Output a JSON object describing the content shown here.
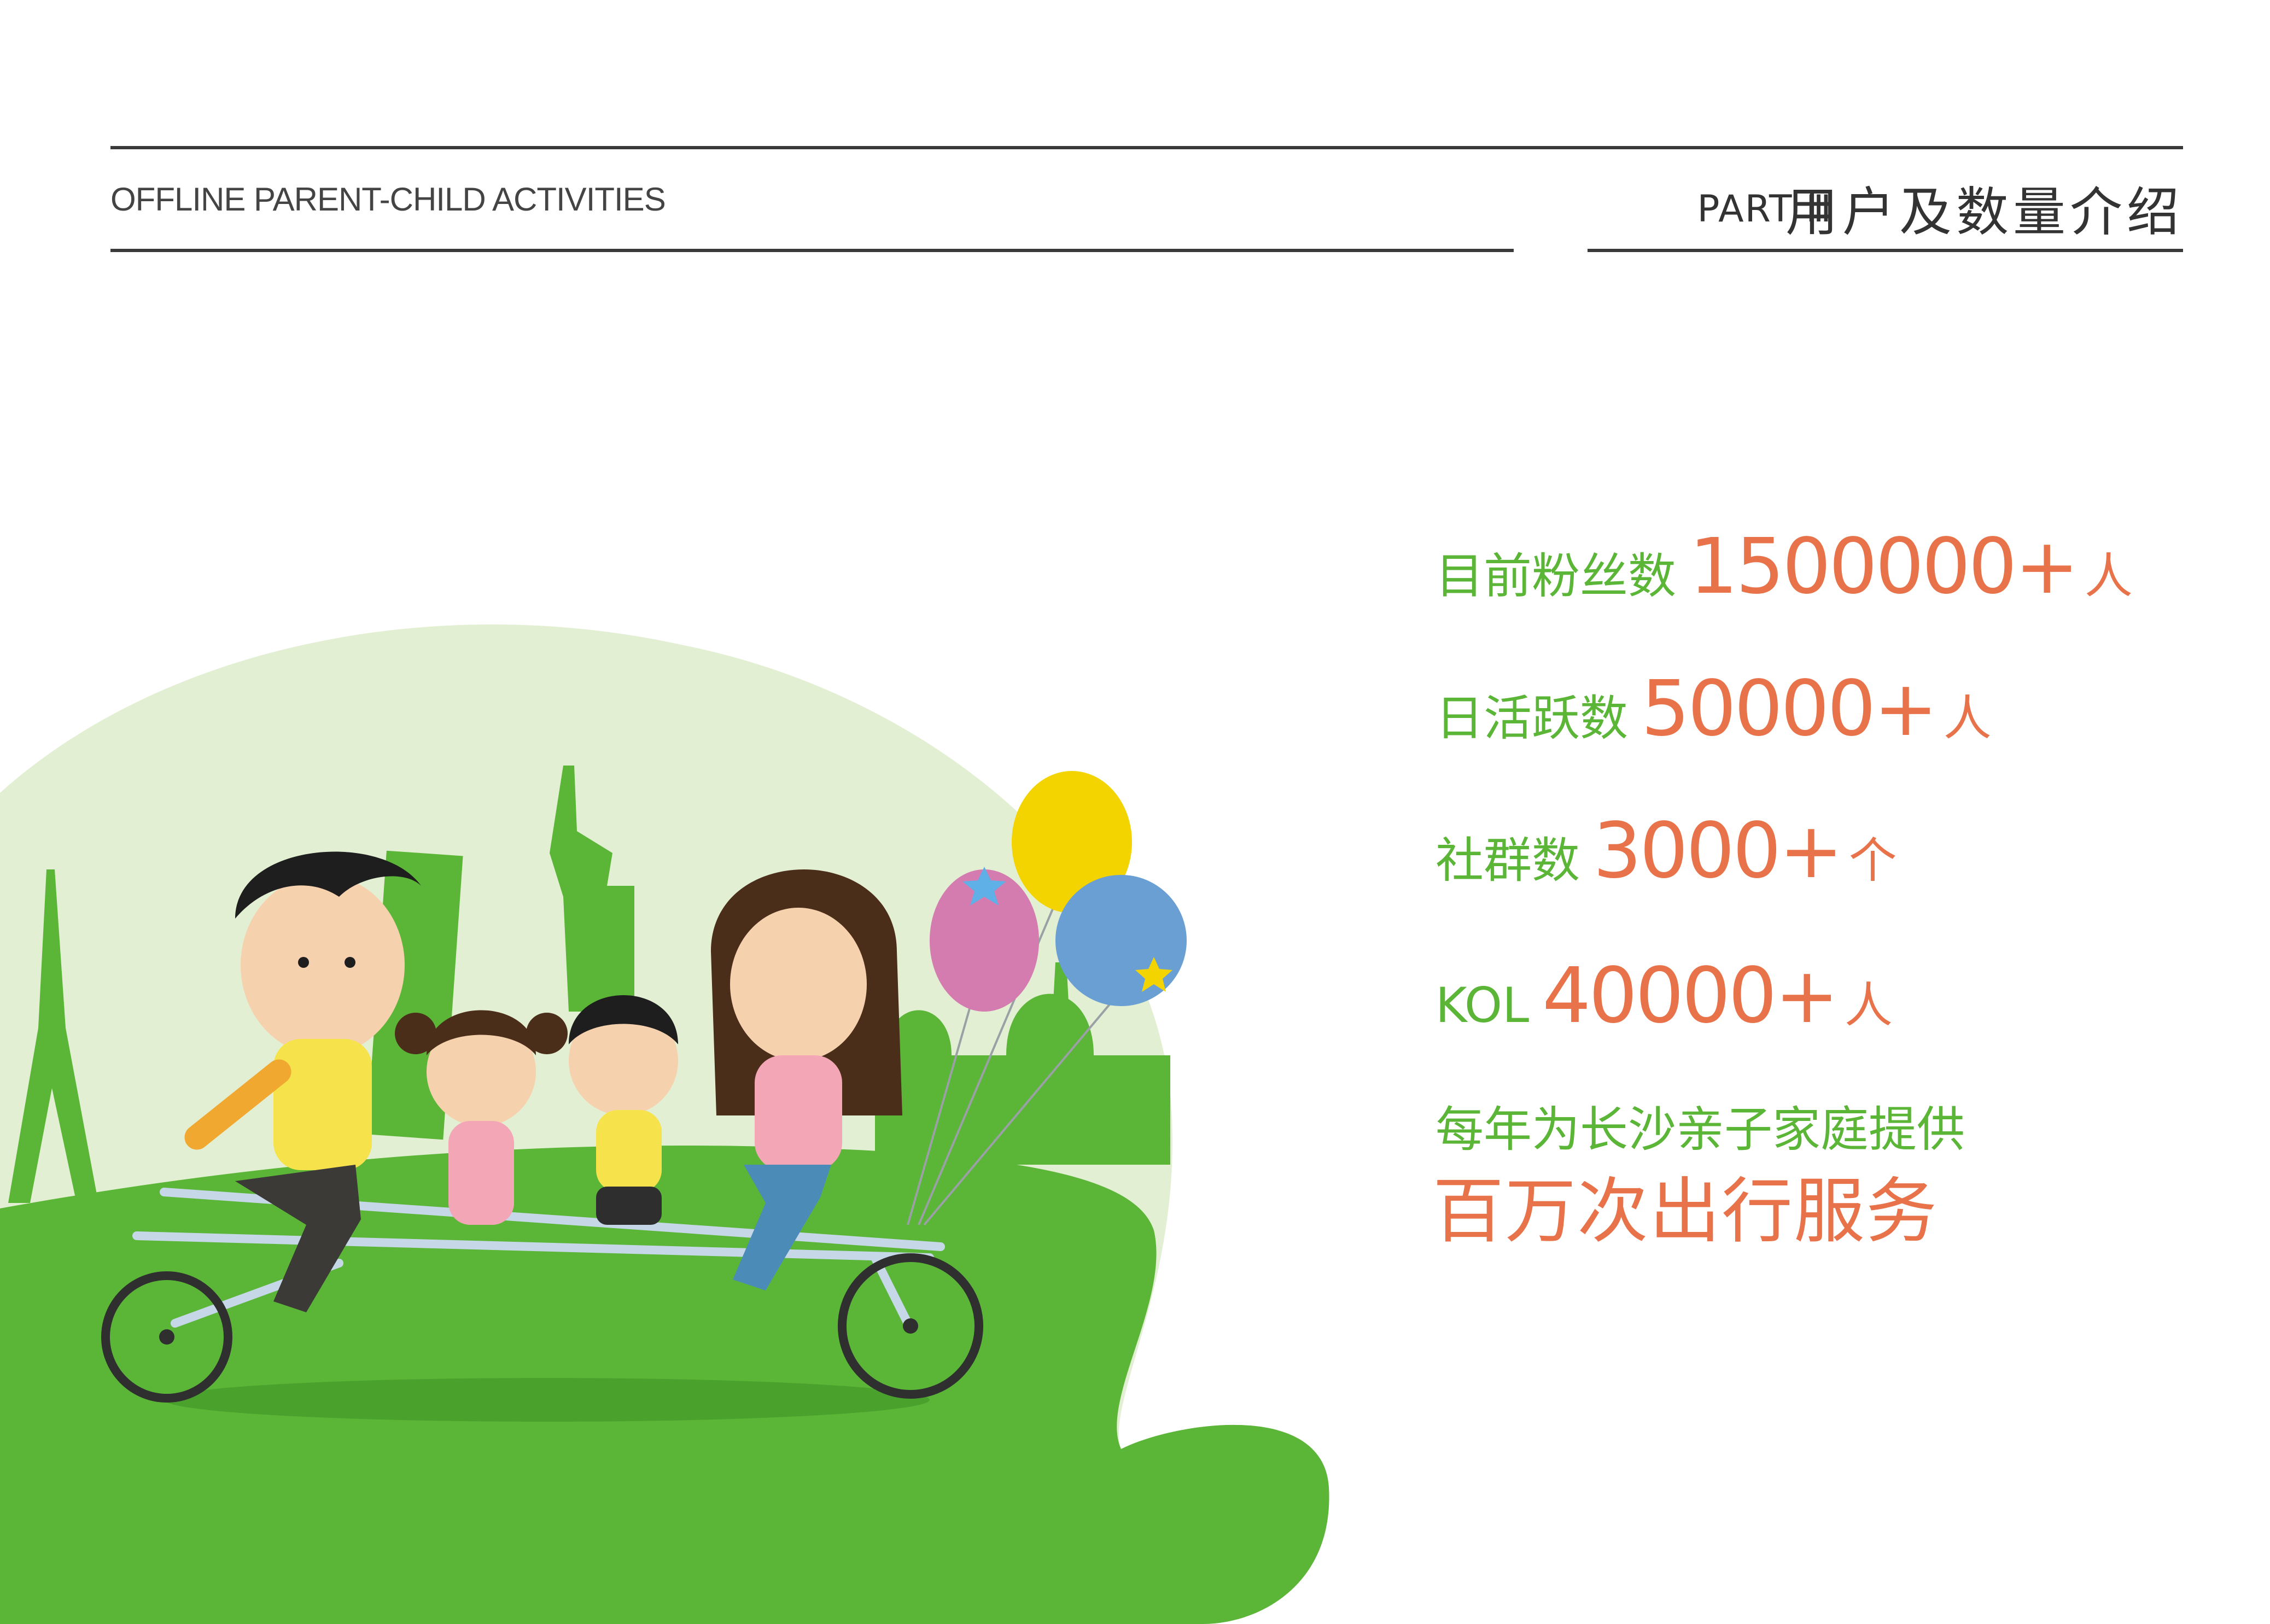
{
  "header": {
    "title": "OFFLINE PARENT-CHILD ACTIVITIES",
    "part_label": "PART Ⅲ",
    "part_title": "用户及数量介绍"
  },
  "stats": [
    {
      "label": "目前粉丝数",
      "value": "1500000+",
      "unit": "人"
    },
    {
      "label": "日活跃数",
      "value": "50000+",
      "unit": "人"
    },
    {
      "label": "社群数",
      "value": "3000+",
      "unit": "个"
    },
    {
      "label": "KOL",
      "value": "40000+",
      "unit": "人"
    }
  ],
  "service": {
    "line1": "每年为长沙亲子家庭提供",
    "line2": "百万次出行服务"
  },
  "colors": {
    "green": "#5bb638",
    "orange": "#e8734a",
    "light_green": "#e3efd3",
    "rule": "#3a3a3a"
  }
}
